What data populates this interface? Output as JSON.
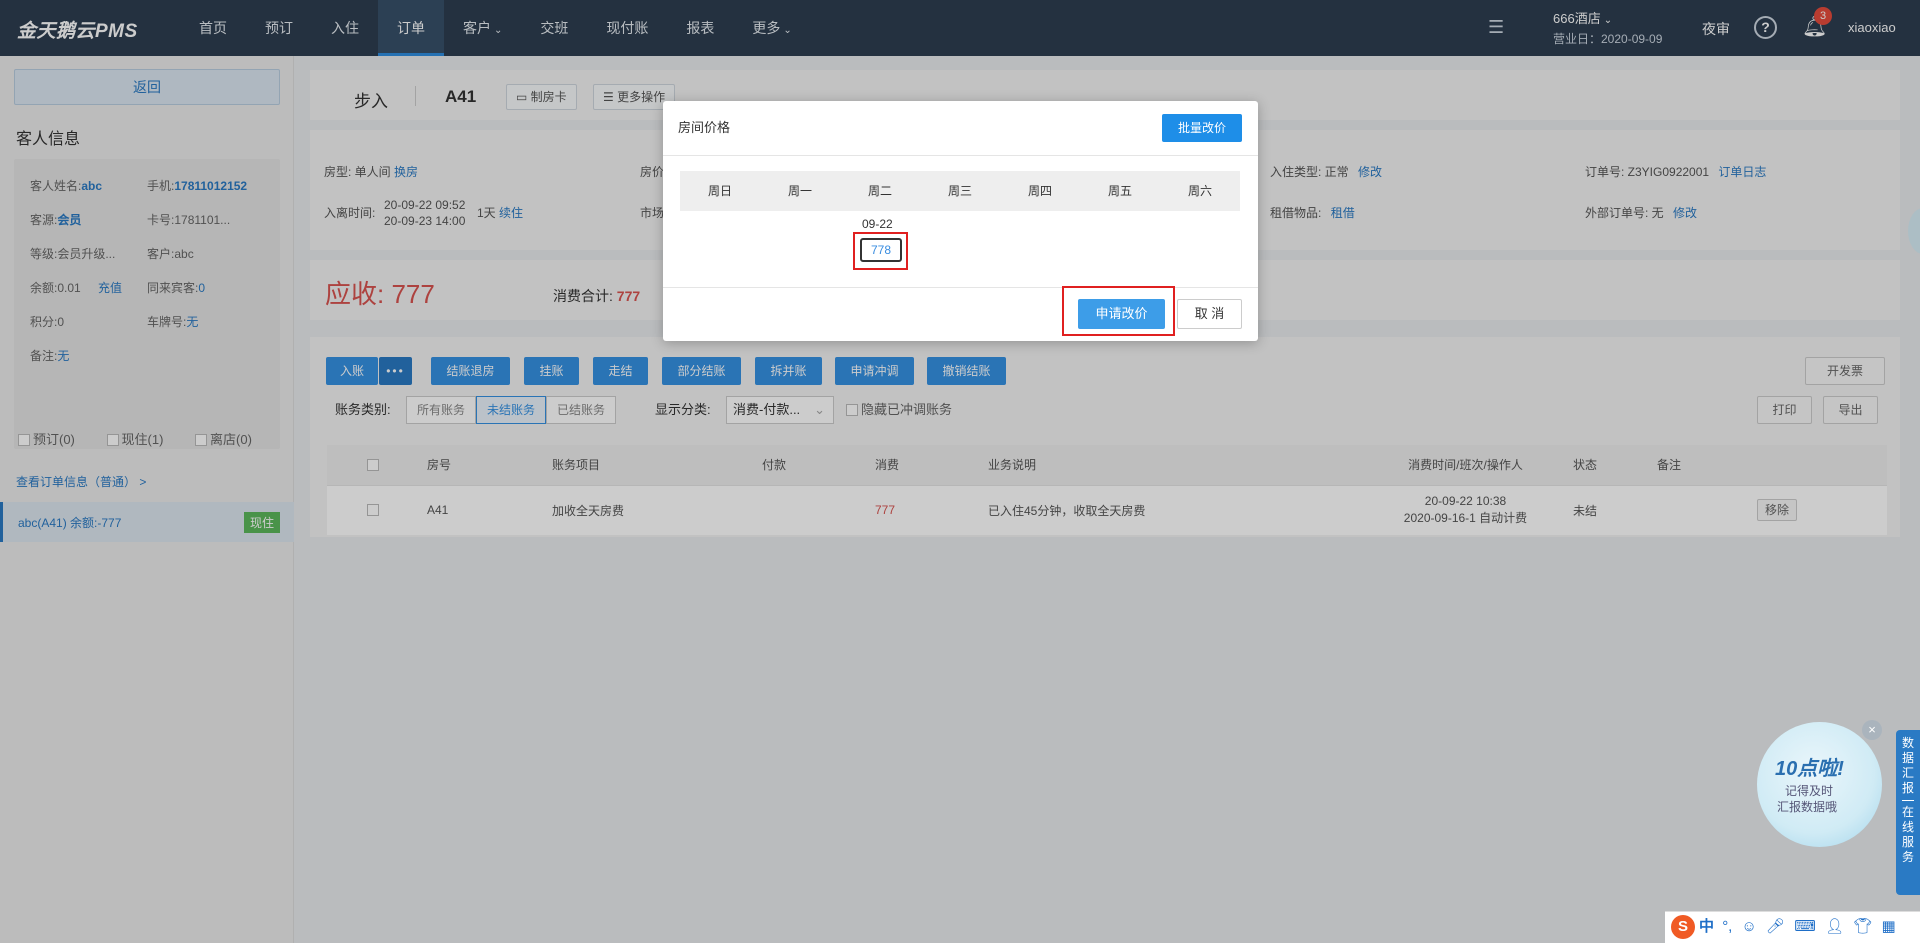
{
  "topbar": {
    "brand": "金天鹅云PMS",
    "nav": [
      {
        "label": "首页"
      },
      {
        "label": "预订"
      },
      {
        "label": "入住"
      },
      {
        "label": "订单",
        "active": true
      },
      {
        "label": "客户",
        "dropdown": true
      },
      {
        "label": "交班"
      },
      {
        "label": "现付账"
      },
      {
        "label": "报表"
      },
      {
        "label": "更多",
        "dropdown": true
      }
    ],
    "hotel": "666酒店",
    "business_day": "营业日：2020-09-09",
    "night_audit": "夜审",
    "help": "?",
    "notifications": "3",
    "username": "xiaoxiao"
  },
  "sidebar": {
    "back": "返回",
    "guest_title": "客人信息",
    "fields": {
      "name_label": "客人姓名:",
      "name": "abc",
      "phone_label": "手机:",
      "phone": "17811012152",
      "source_label": "客源:",
      "source": "会员",
      "card_label": "卡号:",
      "card": "1781101...",
      "level_label": "等级:",
      "level": "会员升级...",
      "customer_label": "客户:",
      "customer": "abc",
      "balance_label": "余额:",
      "balance": "0.01",
      "recharge": "充值",
      "cohab_label": "同来宾客:",
      "cohab": "0",
      "points_label": "积分:",
      "points": "0",
      "plate_label": "车牌号:",
      "plate": "无",
      "remark_label": "备注:",
      "remark": "无"
    },
    "tabs": [
      "预订(0)",
      "现住(1)",
      "离店(0)"
    ],
    "order_link": "查看订单信息（普通） >",
    "order_item": "abc(A41)  余额:-777",
    "order_tag": "现住"
  },
  "main": {
    "header": {
      "type": "步入",
      "room": "A41",
      "btn_card": "制房卡",
      "btn_more": "更多操作"
    },
    "info": {
      "room_type_label": "房型: 单人间",
      "room_type_link": "换房",
      "rate_label": "房价",
      "checkin_time_label": "入离时间:",
      "checkin_time": "20-09-22 09:52",
      "checkout_time": "20-09-23 14:00",
      "nights": "1天",
      "extend": "续住",
      "market_label": "市场",
      "stay_type_label": "入住类型: 正常",
      "stay_type_link": "修改",
      "borrow_label": "租借物品:",
      "borrow_link": "租借",
      "order_no_label": "订单号: Z3YIG0922001",
      "order_log": "订单日志",
      "ext_no_label": "外部订单号: 无",
      "ext_no_link": "修改"
    },
    "receivable": "应收: 777",
    "consume_label": "消费合计:",
    "consume_value": "777",
    "buttons": [
      "入账",
      "结账退房",
      "挂账",
      "走结",
      "部分结账",
      "拆并账",
      "申请冲调",
      "撤销结账"
    ],
    "invoice": "开发票",
    "filter_label": "账务类别:",
    "filter_options": [
      "所有账务",
      "未结账务",
      "已结账务"
    ],
    "display_label": "显示分类:",
    "display_value": "消费-付款...",
    "hide_label": "隐藏已冲调账务",
    "print": "打印",
    "export": "导出",
    "columns": [
      "房号",
      "账务项目",
      "付款",
      "消费",
      "业务说明",
      "消费时间/班次/操作人",
      "状态",
      "备注"
    ],
    "rows": [
      {
        "room": "A41",
        "item": "加收全天房费",
        "pay": "",
        "consume": "777",
        "desc": "已入住45分钟，收取全天房费",
        "time": "20-09-22 10:38",
        "shift": "2020-09-16-1 自动计费",
        "status": "未结",
        "remark": "",
        "action": "移除"
      }
    ]
  },
  "modal": {
    "title": "房间价格",
    "batch": "批量改价",
    "weekdays": [
      "周日",
      "周一",
      "周二",
      "周三",
      "周四",
      "周五",
      "周六"
    ],
    "date": "09-22",
    "price": "778",
    "apply": "申请改价",
    "cancel": "取 消"
  },
  "widgets": {
    "promo_title": "10点啦!",
    "promo_line1": "记得及时",
    "promo_line2": "汇报数据哦",
    "side_tab_text": "数据汇报",
    "side_tab_text2": "在线服务",
    "ime_label": "中"
  },
  "colors": {
    "topbar": "#2d3e51",
    "accent": "#3591e3",
    "danger": "#d9534f",
    "highlight": "#e02020"
  }
}
